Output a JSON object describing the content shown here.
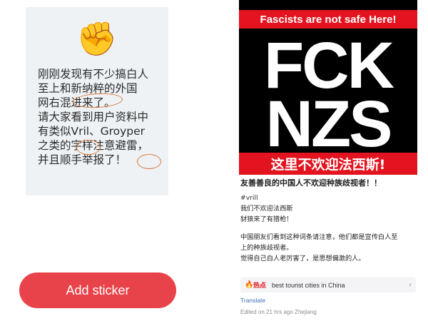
{
  "note_card": {
    "icon": "fist-icon",
    "text": "刚刚发现有不少搞白人\n至上和新纳粹的外国\n网右混进来了。\n请大家看到用户资料中\n有类似Vril、Groyper\n之类的字样注意避雷，\n并且顺手举报了！"
  },
  "sticker_button": {
    "label": "Add sticker",
    "color": "#e8434a"
  },
  "poster": {
    "banner": "Fascists are not safe Here!",
    "line1": "FCK",
    "line2": "NZS",
    "footer": "这里不欢迎法西斯!",
    "colors": {
      "red": "#e3141f",
      "black": "#000000",
      "white": "#ffffff"
    }
  },
  "post": {
    "title": "友善善良的中国人不欢迎种族歧视者！！",
    "tag": "#vrill",
    "line_a": "我们不欢迎法西斯",
    "line_b": "豺狼来了有猎枪！",
    "line_c": "中国朋友们看到这种词条请注意，他们都是宣传白人至",
    "line_d": "上的种族歧视者。",
    "line_e": "觉得自己白人老厉害了，是思想偏激的人。"
  },
  "hot": {
    "icon": "fire-icon",
    "label": "热点",
    "topic": "best tourist cities in China"
  },
  "translate": "Translate",
  "edited": "Edited on 21 hrs ago Zhejiang"
}
